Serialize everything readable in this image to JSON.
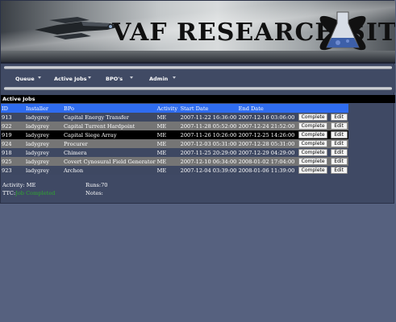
{
  "banner": {
    "title": "VAF RESEARCH SITE"
  },
  "nav": {
    "items": [
      {
        "label": "Queue"
      },
      {
        "label": "Active Jobs"
      },
      {
        "label": "BPO's"
      },
      {
        "label": "Admin"
      }
    ]
  },
  "section": {
    "title": "Active Jobs"
  },
  "table": {
    "headers": [
      "ID",
      "Installer",
      "BPo",
      "Activity",
      "Start Date",
      "End Date"
    ],
    "rows": [
      {
        "id": "913",
        "installer": "ladygrey",
        "bpo": "Capital Energy Transfer",
        "activity": "ME",
        "start": "2007-11-22 16:36:00",
        "end": "2007-12-16 03:06:00"
      },
      {
        "id": "922",
        "installer": "ladygrey",
        "bpo": "Capital Turrent Hardpoint",
        "activity": "ME",
        "start": "2007-11-28 05:52:00",
        "end": "2007-12-24 21:52:00"
      },
      {
        "id": "919",
        "installer": "ladygrey",
        "bpo": "Capital Siege Array",
        "activity": "ME",
        "start": "2007-11-26 10:26:00",
        "end": "2007-12-25 14:26:00"
      },
      {
        "id": "924",
        "installer": "ladygrey",
        "bpo": "Procurer",
        "activity": "ME",
        "start": "2007-12-03 05:31:00",
        "end": "2007-12-28 05:31:00"
      },
      {
        "id": "918",
        "installer": "ladygrey",
        "bpo": "Chimera",
        "activity": "ME",
        "start": "2007-11-25 20:29:00",
        "end": "2007-12-29 04:29:00"
      },
      {
        "id": "925",
        "installer": "ladygrey",
        "bpo": "Covert Cynosural Field Generator",
        "activity": "ME",
        "start": "2007-12-10 06:34:00",
        "end": "2008-01-02 17:04:00"
      },
      {
        "id": "923",
        "installer": "ladygrey",
        "bpo": "Archon",
        "activity": "ME",
        "start": "2007-12-04 03:39:00",
        "end": "2008-01-06 11:39:00"
      }
    ],
    "complete_label": "Complete",
    "edit_label": "Edit"
  },
  "details": {
    "activity_label": "Activity: ME",
    "runs_label": "Runs:70",
    "ttc_label": "TTC:",
    "ttc_value": "Job Completed",
    "notes_label": "Notes:"
  },
  "colors": {
    "header_row": "#2f6cf0",
    "row_dark": "#3e4862",
    "row_gray": "#757575",
    "row_selected": "#000000",
    "ttc_green": "#2fa82f"
  }
}
